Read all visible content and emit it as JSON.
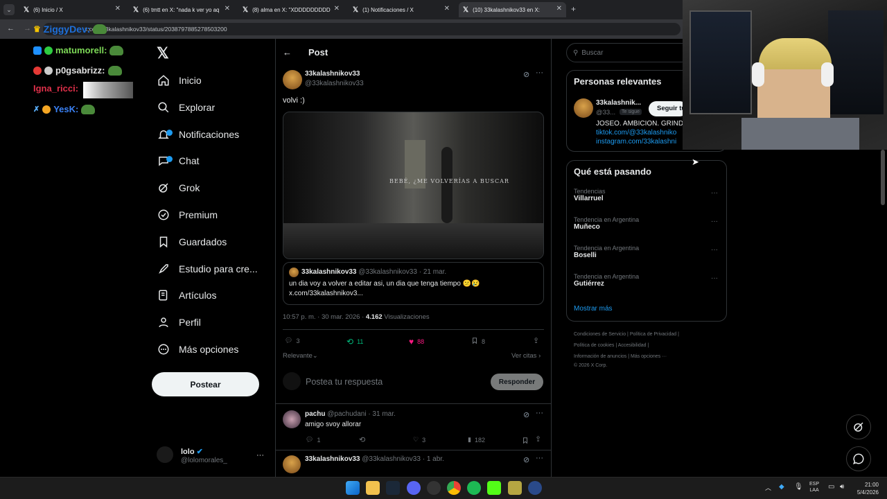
{
  "tabs": [
    {
      "label": "(6) Inicio / X"
    },
    {
      "label": "(6) tmtt en X: \"nada k ver yo aq"
    },
    {
      "label": "(8) alma en X: \"XDDDDDDDDD"
    },
    {
      "label": "(1) Notificaciones / X"
    },
    {
      "label": "(10) 33kalashnikov33 en X:"
    }
  ],
  "url": "x.com/33kalashnikov33/status/2038797885278503200",
  "chat": {
    "line0": "ZiggyDev:",
    "line1": "matumorell:",
    "line2": "p0gsabrizz:",
    "line3": "Igna_ricci:",
    "line4": "YesK:"
  },
  "nav": {
    "items": [
      "Inicio",
      "Explorar",
      "Notificaciones",
      "Chat",
      "Grok",
      "Premium",
      "Guardados",
      "Estudio para cre...",
      "Artículos",
      "Perfil",
      "Más opciones"
    ],
    "post_label": "Postear",
    "account_name": "lolo",
    "account_handle": "@lolomorales_"
  },
  "header": {
    "title": "Post"
  },
  "tweet": {
    "author": "33kalashnikov33",
    "handle": "@33kalashnikov33",
    "text": "volvi :)",
    "video_caption": "BEBÉ, ¿ME VOLVERÍAS A BUSCAR",
    "quote_author": "33kalashnikov33",
    "quote_meta": "@33kalashnikov33 · 21 mar.",
    "quote_text": "un dia voy a volver a editar asi, un dia que tenga tiempo 😕😢",
    "quote_link": "x.com/33kalashnikov3...",
    "meta_time": "10:57 p. m. · 30 mar. 2026 ·",
    "views_count": "4.162",
    "views_label": "Visualizaciones",
    "replies": "3",
    "reposts": "11",
    "likes": "88",
    "bookmarks": "8",
    "sort_label": "Relevante",
    "quotes_link": "Ver citas"
  },
  "reply_box": {
    "placeholder": "Postea tu respuesta",
    "button": "Responder"
  },
  "replies": [
    {
      "author": "pachu",
      "meta": "@pachudani · 31 mar.",
      "text": "amigo svoy allorar",
      "replies": "1",
      "likes": "3",
      "views": "182"
    },
    {
      "author": "33kalashnikov33",
      "meta": "@33kalashnikov33 · 1 abr."
    }
  ],
  "search": {
    "placeholder": "Buscar"
  },
  "relevant": {
    "title": "Personas relevantes",
    "name": "33kalashnik...",
    "handle": "@33...",
    "follows_you": "Te sigue",
    "follow_btn": "Seguir tú",
    "bio1": "JOSEO. AMBICION. GRINDE",
    "bio2": "tiktok.com/@33kalashniko",
    "bio3": "instagram.com/33kalashni"
  },
  "trends": {
    "title": "Qué está pasando",
    "items": [
      {
        "cat": "Tendencias",
        "name": "Villarruel"
      },
      {
        "cat": "Tendencia en Argentina",
        "name": "Muñeco"
      },
      {
        "cat": "Tendencia en Argentina",
        "name": "Boselli"
      },
      {
        "cat": "Tendencia en Argentina",
        "name": "Gutiérrez"
      }
    ],
    "more": "Mostrar más"
  },
  "footer": {
    "l1a": "Condiciones de Servicio",
    "l1b": "Política de Privacidad",
    "l2a": "Política de cookies",
    "l2b": "Accesibilidad",
    "l3a": "Información de anuncios",
    "l3b": "Más opciones ···",
    "l4": "© 2026 X Corp."
  },
  "taskbar": {
    "lang1": "ESP",
    "lang2": "LAA",
    "time": "21:00",
    "date": "5/4/2026"
  },
  "colors": {
    "accent": "#1d9bf0",
    "like": "#f91880",
    "repost": "#00ba7c",
    "bg": "#000000"
  }
}
